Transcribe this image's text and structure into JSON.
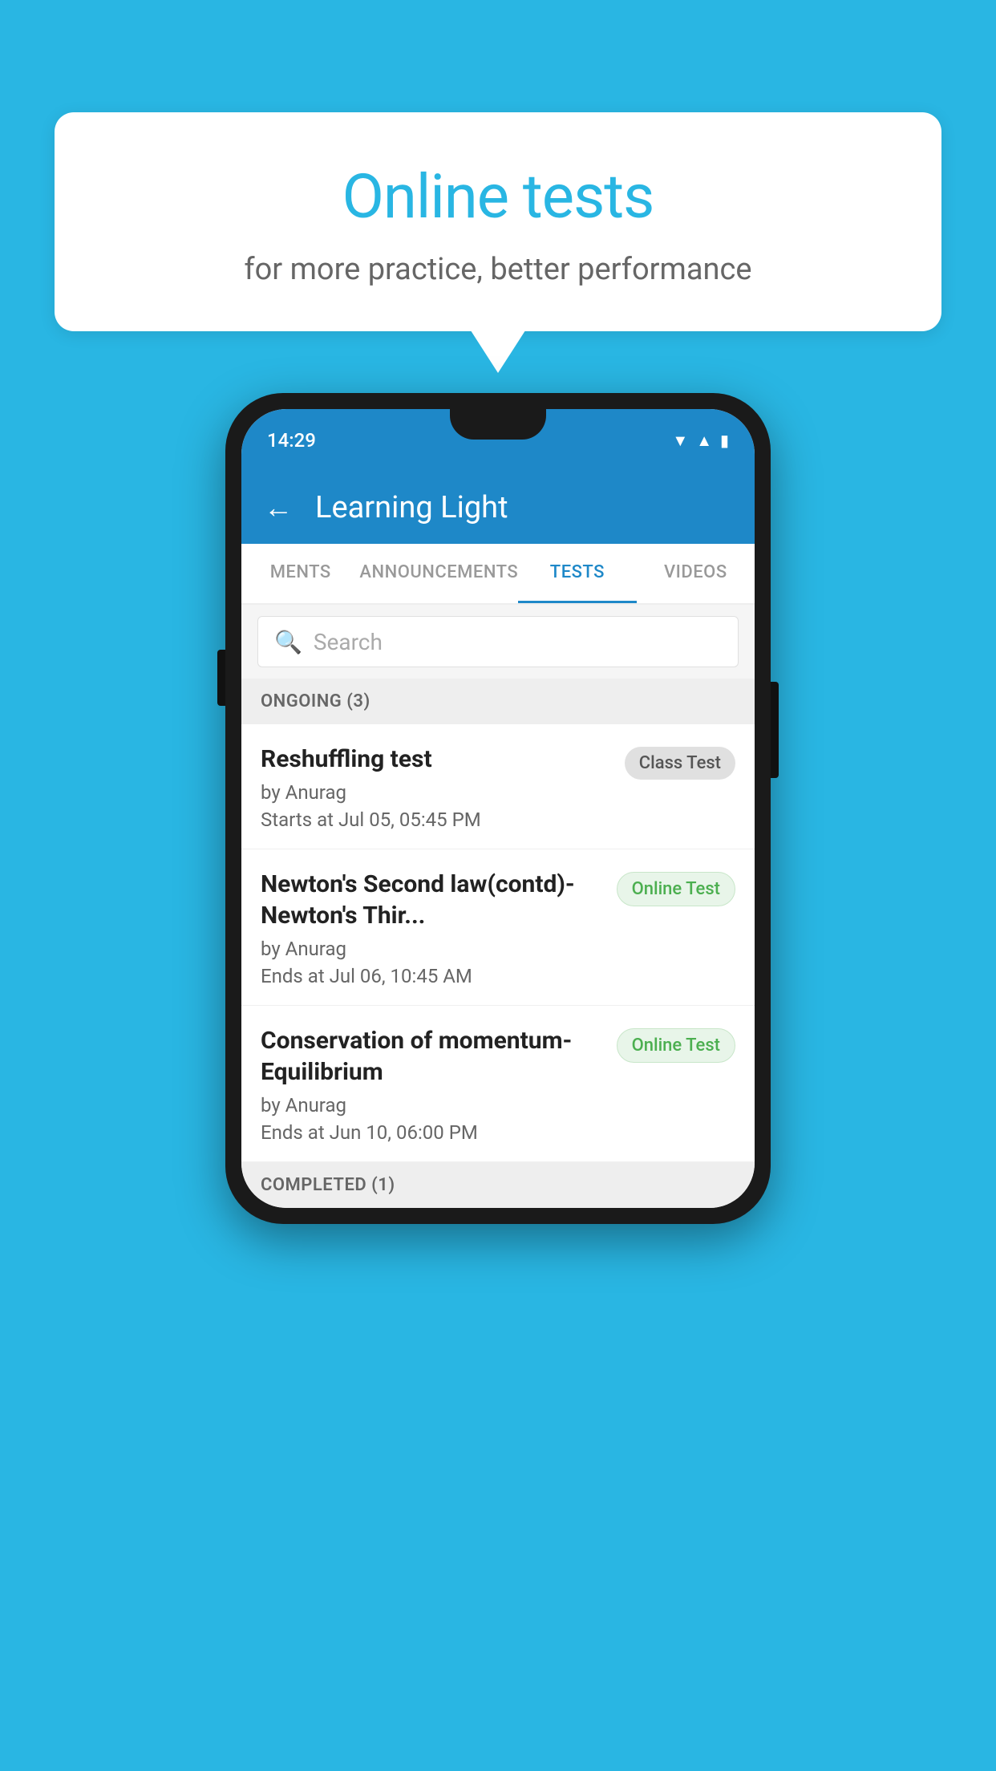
{
  "background_color": "#29B6E3",
  "speech_bubble": {
    "title": "Online tests",
    "subtitle": "for more practice, better performance"
  },
  "phone": {
    "status_bar": {
      "time": "14:29",
      "icons": [
        "wifi",
        "signal",
        "battery"
      ]
    },
    "app_bar": {
      "back_label": "←",
      "title": "Learning Light"
    },
    "tabs": [
      {
        "label": "MENTS",
        "active": false
      },
      {
        "label": "ANNOUNCEMENTS",
        "active": false
      },
      {
        "label": "TESTS",
        "active": true
      },
      {
        "label": "VIDEOS",
        "active": false
      }
    ],
    "search": {
      "placeholder": "Search"
    },
    "ongoing_section": {
      "header": "ONGOING (3)",
      "items": [
        {
          "name": "Reshuffling test",
          "author": "by Anurag",
          "time_label": "Starts at",
          "time_value": "Jul 05, 05:45 PM",
          "badge": "Class Test",
          "badge_type": "class"
        },
        {
          "name": "Newton's Second law(contd)-Newton's Thir...",
          "author": "by Anurag",
          "time_label": "Ends at",
          "time_value": "Jul 06, 10:45 AM",
          "badge": "Online Test",
          "badge_type": "online"
        },
        {
          "name": "Conservation of momentum-Equilibrium",
          "author": "by Anurag",
          "time_label": "Ends at",
          "time_value": "Jun 10, 06:00 PM",
          "badge": "Online Test",
          "badge_type": "online"
        }
      ]
    },
    "completed_section": {
      "header": "COMPLETED (1)"
    }
  }
}
